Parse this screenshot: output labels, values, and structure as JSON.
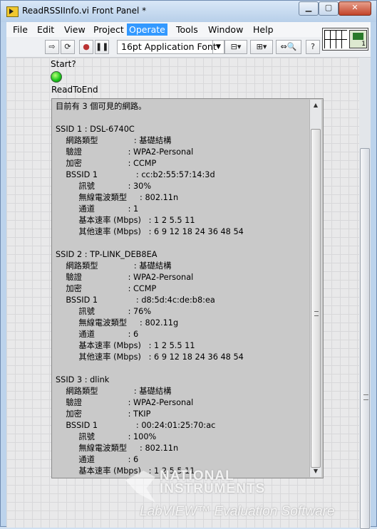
{
  "window": {
    "title": "ReadRSSIInfo.vi Front Panel *",
    "btn_min": "▁",
    "btn_max": "▢",
    "btn_close": "✕"
  },
  "menu": [
    "File",
    "Edit",
    "View",
    "Project",
    "Operate",
    "Tools",
    "Window",
    "Help"
  ],
  "menu_active": "Operate",
  "toolbar": {
    "font": "16pt Application Font",
    "connector_number": "1"
  },
  "panel": {
    "start_label": "Start?",
    "led_color": "#1ec81e",
    "read_to_end_label": "ReadToEnd",
    "text": "目前有 3 個可見的網路。\n\nSSID 1 : DSL-6740C\n    網路類型              : 基礎結構\n    驗證                  : WPA2-Personal\n    加密                  : CCMP\n    BSSID 1               : cc:b2:55:57:14:3d\n         訊號             : 30%\n         無線電波類型     : 802.11n\n         通道             : 1\n         基本速率 (Mbps)   : 1 2 5.5 11\n         其他速率 (Mbps)   : 6 9 12 18 24 36 48 54\n\nSSID 2 : TP-LINK_DEB8EA\n    網路類型              : 基礎結構\n    驗證                  : WPA2-Personal\n    加密                  : CCMP\n    BSSID 1               : d8:5d:4c:de:b8:ea\n         訊號             : 76%\n         無線電波類型     : 802.11g\n         通道             : 6\n         基本速率 (Mbps)   : 1 2 5.5 11\n         其他速率 (Mbps)   : 6 9 12 18 24 36 48 54\n\nSSID 3 : dlink\n    網路類型              : 基礎結構\n    驗證                  : WPA2-Personal\n    加密                  : TKIP\n    BSSID 1               : 00:24:01:25:70:ac\n         訊號             : 100%\n         無線電波類型     : 802.11n\n         通道             : 6\n         基本速率 (Mbps)   : 1 2 5.5 11"
  },
  "watermark": {
    "line1": "NATIONAL",
    "line2": "INSTRUMENTS",
    "line3": "LabVIEW™ Evaluation Software"
  }
}
